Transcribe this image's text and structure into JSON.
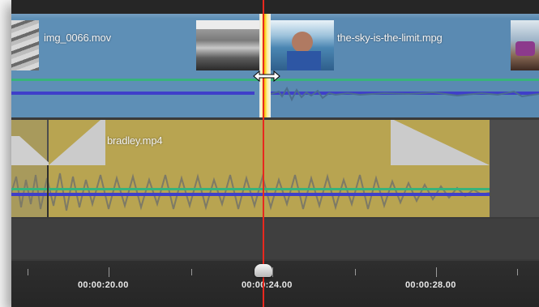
{
  "timeline": {
    "clips": {
      "video_a": {
        "name": "img_0066.mov"
      },
      "video_b": {
        "name": "the-sky-is-the-limit.mpg"
      },
      "audio_video": {
        "name": "bradley.mp4"
      }
    },
    "ruler": {
      "timecodes": [
        "00:00:20.00",
        "00:00:24.00",
        "00:00:28.00"
      ]
    }
  },
  "colors": {
    "video_track": "#5e8fb6",
    "audio_clip": "#b8a451",
    "volume_line": "#38b37a",
    "pan_line": "#3f3fc9",
    "playhead": "#e8281e",
    "cut_highlight": "#f8c400"
  },
  "icons": {
    "trim_cursor": "horizontal-resize-icon",
    "playhead": "playhead-knob-icon"
  }
}
